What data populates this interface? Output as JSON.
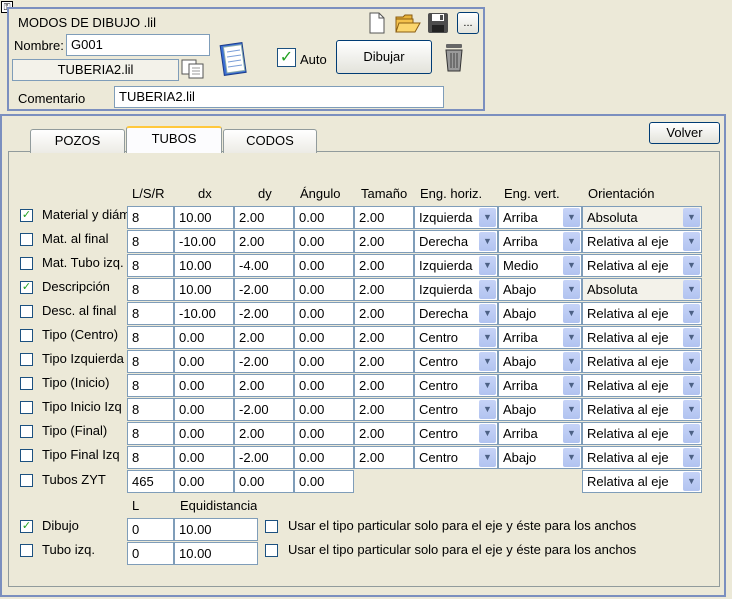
{
  "header": {
    "title": "MODOS DE DIBUJO .lil",
    "nombre_label": "Nombre:",
    "nombre_value": "G001",
    "file_label": "TUBERIA2.lil",
    "auto_label": "Auto",
    "auto_checked": true,
    "dibujar_label": "Dibujar",
    "ellipsis_label": "...",
    "comentario_label": "Comentario",
    "comentario_value": "TUBERIA2.lil"
  },
  "tabs": [
    {
      "label": "POZOS",
      "active": false
    },
    {
      "label": "TUBOS",
      "active": true
    },
    {
      "label": "CODOS",
      "active": false
    }
  ],
  "volver_label": "Volver",
  "columns": {
    "lsr": "L/S/R",
    "dx": "dx",
    "dy": "dy",
    "angulo": "Ángulo",
    "tamano": "Tamaño",
    "eng_horiz": "Eng. horiz.",
    "eng_vert": "Eng. vert.",
    "orientacion": "Orientación"
  },
  "rows": [
    {
      "label": "Material y diám",
      "checked": true,
      "lsr": "8",
      "dx": "10.00",
      "dy": "2.00",
      "ang": "0.00",
      "tam": "2.00",
      "eh": "Izquierda",
      "ev": "Arriba",
      "or": "Absoluta"
    },
    {
      "label": "Mat. al final",
      "checked": false,
      "lsr": "8",
      "dx": "-10.00",
      "dy": "2.00",
      "ang": "0.00",
      "tam": "2.00",
      "eh": "Derecha",
      "ev": "Arriba",
      "or": "Relativa al eje"
    },
    {
      "label": "Mat. Tubo izq.",
      "checked": false,
      "lsr": "8",
      "dx": "10.00",
      "dy": "-4.00",
      "ang": "0.00",
      "tam": "2.00",
      "eh": "Izquierda",
      "ev": "Medio",
      "or": "Relativa al eje"
    },
    {
      "label": "Descripción",
      "checked": true,
      "lsr": "8",
      "dx": "10.00",
      "dy": "-2.00",
      "ang": "0.00",
      "tam": "2.00",
      "eh": "Izquierda",
      "ev": "Abajo",
      "or": "Absoluta"
    },
    {
      "label": "Desc. al final",
      "checked": false,
      "lsr": "8",
      "dx": "-10.00",
      "dy": "-2.00",
      "ang": "0.00",
      "tam": "2.00",
      "eh": "Derecha",
      "ev": "Abajo",
      "or": "Relativa al eje"
    },
    {
      "label": "Tipo (Centro)",
      "checked": false,
      "lsr": "8",
      "dx": "0.00",
      "dy": "2.00",
      "ang": "0.00",
      "tam": "2.00",
      "eh": "Centro",
      "ev": "Arriba",
      "or": "Relativa al eje"
    },
    {
      "label": "Tipo Izquierda",
      "checked": false,
      "lsr": "8",
      "dx": "0.00",
      "dy": "-2.00",
      "ang": "0.00",
      "tam": "2.00",
      "eh": "Centro",
      "ev": "Abajo",
      "or": "Relativa al eje"
    },
    {
      "label": "Tipo (Inicio)",
      "checked": false,
      "lsr": "8",
      "dx": "0.00",
      "dy": "2.00",
      "ang": "0.00",
      "tam": "2.00",
      "eh": "Centro",
      "ev": "Arriba",
      "or": "Relativa al eje"
    },
    {
      "label": "Tipo Inicio Izq",
      "checked": false,
      "lsr": "8",
      "dx": "0.00",
      "dy": "-2.00",
      "ang": "0.00",
      "tam": "2.00",
      "eh": "Centro",
      "ev": "Abajo",
      "or": "Relativa al eje"
    },
    {
      "label": "Tipo (Final)",
      "checked": false,
      "lsr": "8",
      "dx": "0.00",
      "dy": "2.00",
      "ang": "0.00",
      "tam": "2.00",
      "eh": "Centro",
      "ev": "Arriba",
      "or": "Relativa al eje"
    },
    {
      "label": "Tipo Final Izq",
      "checked": false,
      "lsr": "8",
      "dx": "0.00",
      "dy": "-2.00",
      "ang": "0.00",
      "tam": "2.00",
      "eh": "Centro",
      "ev": "Abajo",
      "or": "Relativa al eje"
    }
  ],
  "zyt": {
    "label": "Tubos ZYT",
    "checked": false,
    "lsr": "465",
    "dx": "0.00",
    "dy": "0.00",
    "ang": "0.00",
    "or": "Relativa al eje"
  },
  "bottom": {
    "col_l": "L",
    "col_equi": "Equidistancia",
    "usar_label": "Usar el tipo particular solo para el eje y éste para los anchos",
    "rows": [
      {
        "label": "Dibujo",
        "checked": true,
        "l": "0",
        "equi": "10.00",
        "usar_checked": false
      },
      {
        "label": "Tubo izq.",
        "checked": false,
        "l": "0",
        "equi": "10.00",
        "usar_checked": false
      }
    ]
  },
  "colors": {
    "frame": "#7b8fbf",
    "background": "#ece9d8",
    "check_green": "#21a121"
  }
}
